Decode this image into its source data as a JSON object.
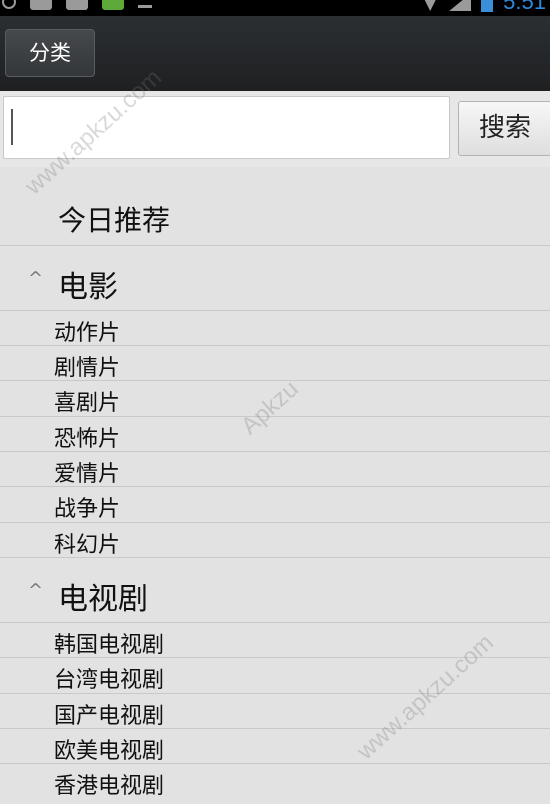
{
  "status_bar": {
    "clock": "5:51"
  },
  "action_bar": {
    "category_label": "分类"
  },
  "search": {
    "input_value": "",
    "button_label": "搜索"
  },
  "list": {
    "top_item": "今日推荐",
    "sections": [
      {
        "title": "电影",
        "items": [
          "动作片",
          "剧情片",
          "喜剧片",
          "恐怖片",
          "爱情片",
          "战争片",
          "科幻片"
        ]
      },
      {
        "title": "电视剧",
        "items": [
          "韩国电视剧",
          "台湾电视剧",
          "国产电视剧",
          "欧美电视剧",
          "香港电视剧"
        ]
      }
    ]
  },
  "watermarks": [
    "www.apkzu.com",
    "Apkzu",
    "www.apkzu.com"
  ]
}
